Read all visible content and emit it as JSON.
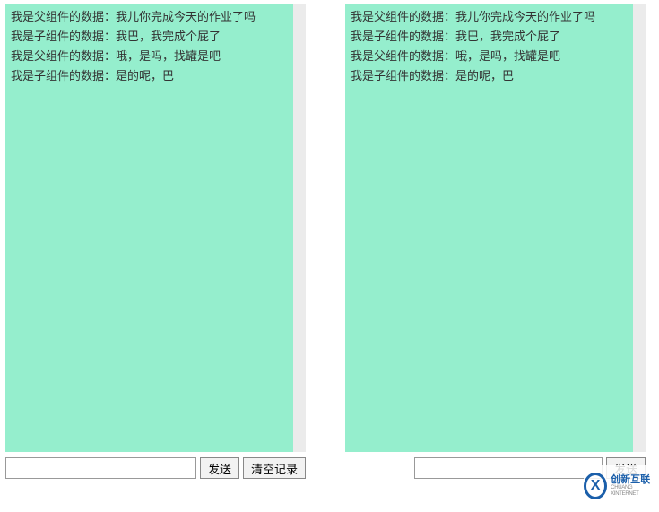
{
  "left_panel": {
    "messages": [
      "我是父组件的数据：我儿你完成今天的作业了吗",
      "我是子组件的数据：我巴，我完成个屁了",
      "我是父组件的数据：哦，是吗，找罐是吧",
      "我是子组件的数据：是的呢，巴"
    ],
    "input_value": "",
    "send_label": "发送",
    "clear_label": "清空记录"
  },
  "right_panel": {
    "messages": [
      "我是父组件的数据：我儿你完成今天的作业了吗",
      "我是子组件的数据：我巴，我完成个屁了",
      "我是父组件的数据：哦，是吗，找罐是吧",
      "我是子组件的数据：是的呢，巴"
    ],
    "input_value": "",
    "send_label": "发送"
  },
  "watermark": {
    "logo_letter": "X",
    "cn": "创新互联",
    "en": "CHUANG XINTERNET"
  }
}
